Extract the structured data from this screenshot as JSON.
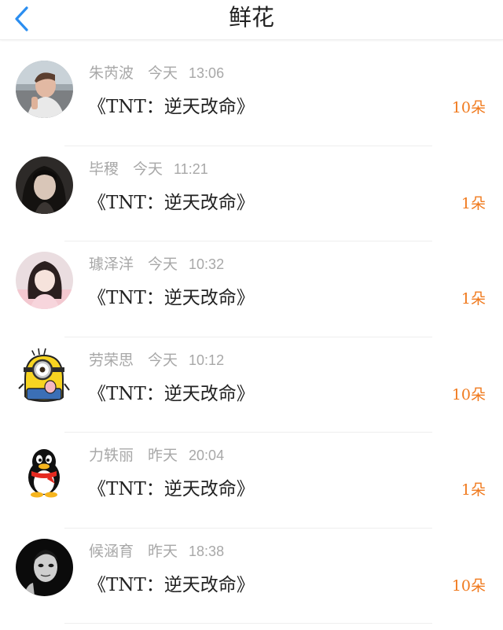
{
  "header": {
    "back_icon": "chevron-left-icon",
    "title": "鲜花"
  },
  "colors": {
    "accent": "#f07a1e",
    "back": "#2b8ef0"
  },
  "items": [
    {
      "avatar": "photo-young-man-avatar",
      "name": "朱芮波",
      "day": "今天",
      "time": "13:06",
      "gift": "《TNT：逆天改命》",
      "count": "10朵"
    },
    {
      "avatar": "photo-girl-dark-avatar",
      "name": "毕稷",
      "day": "今天",
      "time": "11:21",
      "gift": "《TNT：逆天改命》",
      "count": "1朵"
    },
    {
      "avatar": "photo-girl-pink-avatar",
      "name": "璩泽洋",
      "day": "今天",
      "time": "10:32",
      "gift": "《TNT：逆天改命》",
      "count": "1朵"
    },
    {
      "avatar": "minion-avatar",
      "name": "劳荣思",
      "day": "今天",
      "time": "10:12",
      "gift": "《TNT：逆天改命》",
      "count": "10朵"
    },
    {
      "avatar": "qq-penguin-avatar",
      "name": "力轶丽",
      "day": "昨天",
      "time": "20:04",
      "gift": "《TNT：逆天改命》",
      "count": "1朵"
    },
    {
      "avatar": "photo-dark-face-avatar",
      "name": "候涵育",
      "day": "昨天",
      "time": "18:38",
      "gift": "《TNT：逆天改命》",
      "count": "10朵"
    }
  ]
}
